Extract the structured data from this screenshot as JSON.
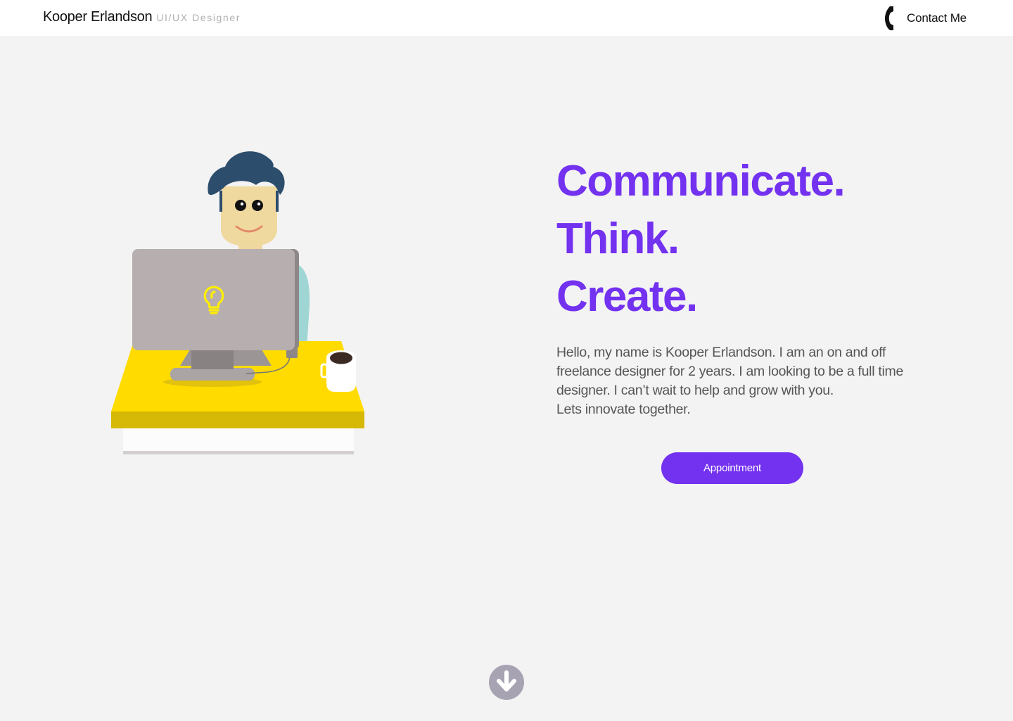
{
  "header": {
    "name": "Kooper Erlandson",
    "role": "UI/UX Designer",
    "contact_label": "Contact Me",
    "contact_icon": "phone-icon"
  },
  "hero": {
    "headline": [
      "Communicate.",
      "Think.",
      "Create."
    ],
    "bio_lines": [
      "Hello, my name is Kooper Erlandson. I am an on and off freelance designer for 2 years. I am looking to be a full time designer. I can’t wait to help and grow with you.",
      "Lets innovate together."
    ],
    "cta_label": "Appointment",
    "illustration_icon": "designer-at-desk-illustration"
  },
  "scroll": {
    "icon": "arrow-down-circle-icon"
  },
  "colors": {
    "accent": "#7331f0",
    "background": "#f3f3f3",
    "desk": "#ffdb00",
    "hair": "#2c4d6b",
    "monitor": "#b7afaf",
    "scroll_icon": "#a8a3b3"
  }
}
